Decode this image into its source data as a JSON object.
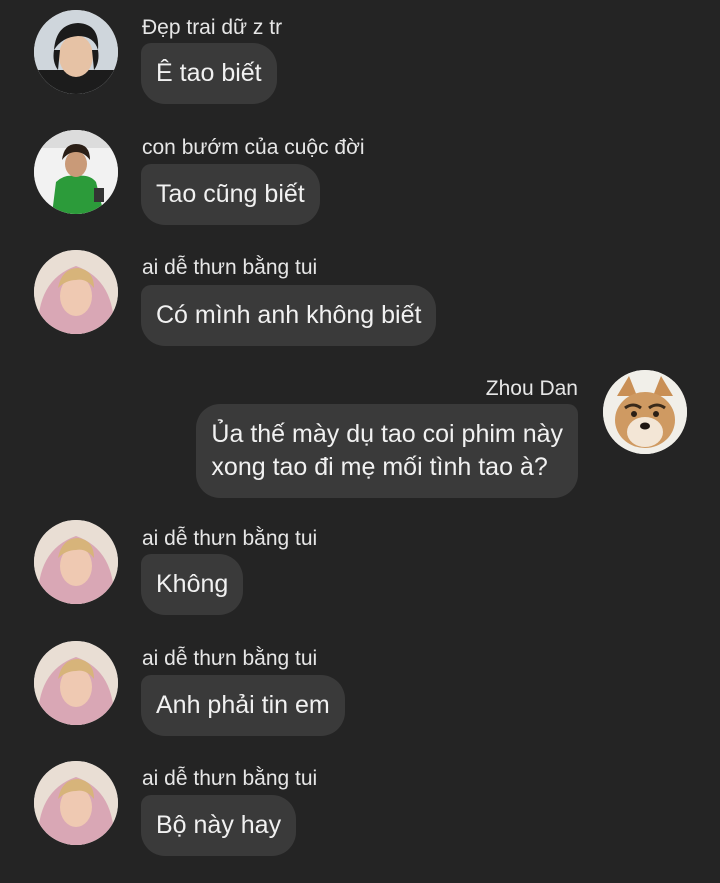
{
  "messages": [
    {
      "sender": "Đẹp trai dữ z tr",
      "text": "Ê tao biết",
      "avatar": "avatar-dark-hair-man-icon"
    },
    {
      "sender": "con bướm của cuộc đời",
      "text": "Tao cũng biết",
      "avatar": "avatar-green-jacket-person-icon"
    },
    {
      "sender": "ai dễ thưn bằng tui",
      "text": "Có mình anh không biết",
      "avatar": "avatar-pink-hood-man-icon"
    },
    {
      "sender": "Zhou Dan",
      "lines": [
        "Ủa thế mày dụ tao coi phim này",
        "xong tao đi mẹ mối tình tao à?"
      ],
      "avatar": "avatar-shiba-dog-icon"
    },
    {
      "sender": "ai dễ thưn bằng tui",
      "text": "Không",
      "avatar": "avatar-pink-hood-man-icon"
    },
    {
      "sender": "ai dễ thưn bằng tui",
      "text": "Anh phải tin em",
      "avatar": "avatar-pink-hood-man-icon"
    },
    {
      "sender": "ai dễ thưn bằng tui",
      "text": "Bộ này hay",
      "avatar": "avatar-pink-hood-man-icon"
    }
  ],
  "colors": {
    "background": "#242424",
    "bubble": "#3a3a3a",
    "text": "#f1f1f1"
  }
}
